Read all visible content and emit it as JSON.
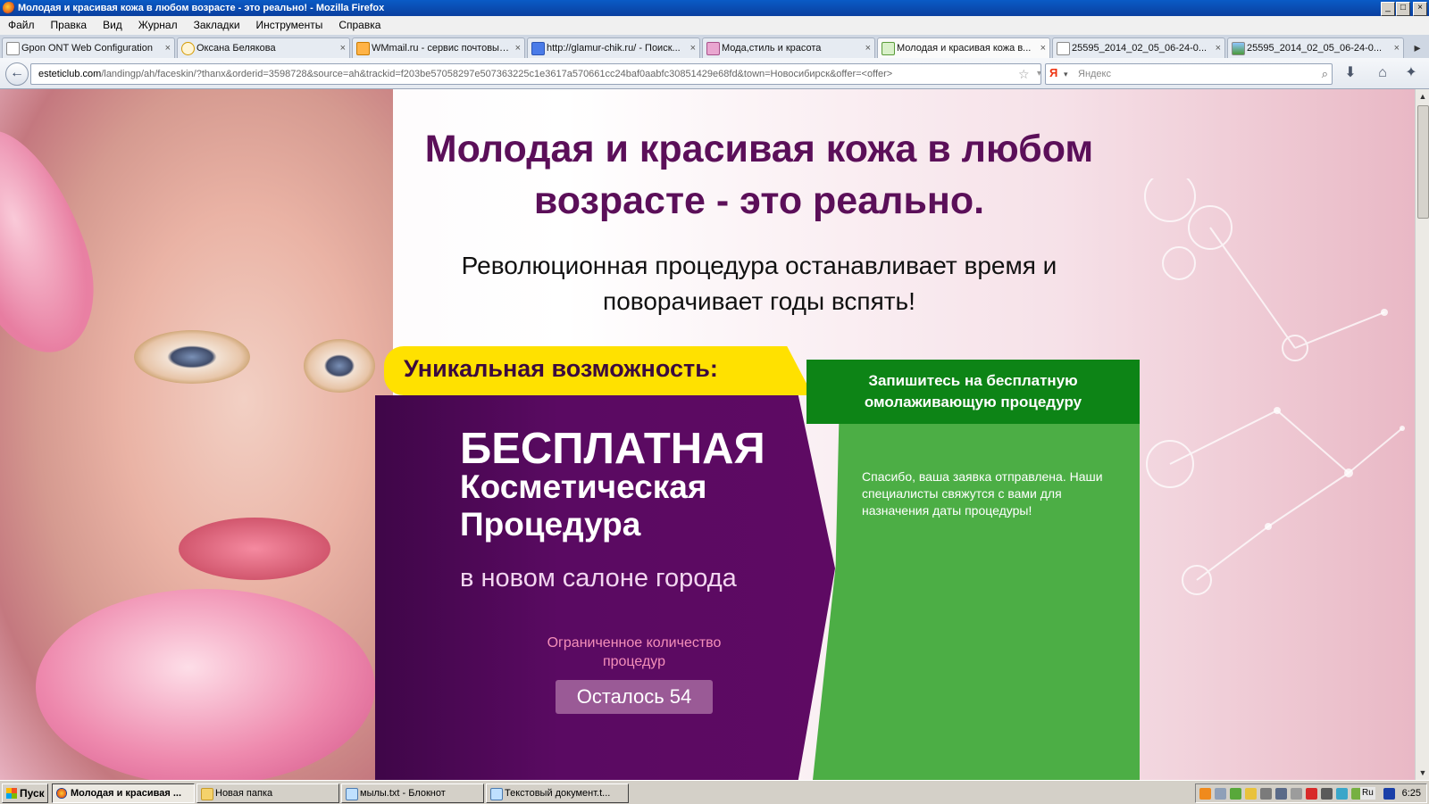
{
  "window": {
    "title": "Молодая и красивая кожа в любом возрасте - это реально! - Mozilla Firefox",
    "controls": [
      "_",
      "□",
      "×"
    ]
  },
  "menu": [
    "Файл",
    "Правка",
    "Вид",
    "Журнал",
    "Закладки",
    "Инструменты",
    "Справка"
  ],
  "tabs": [
    {
      "label": "Gpon ONT Web Configuration",
      "icon": "page-icon"
    },
    {
      "label": "Оксана Белякова",
      "icon": "mail-icon"
    },
    {
      "label": "WMmail.ru - сервис почтовых...",
      "icon": "wmmail-icon"
    },
    {
      "label": "http://glamur-chik.ru/ - Поиск...",
      "icon": "google-icon"
    },
    {
      "label": "Мода,стиль и красота",
      "icon": "fashion-icon"
    },
    {
      "label": "Молодая и красивая кожа в...",
      "icon": "leaf-icon",
      "active": true
    },
    {
      "label": "25595_2014_02_05_06-24-0...",
      "icon": "page-icon"
    },
    {
      "label": "25595_2014_02_05_06-24-0...",
      "icon": "image-icon"
    }
  ],
  "tab_close": "×",
  "tab_scroll": "▸",
  "nav": {
    "back": "←",
    "url_domain": "esteticlub.com",
    "url_path": "/landingp/ah/faceskin/?thanx&orderid=3598728&source=ah&trackid=f203be57058297e507363225c1e3617a570661cc24baf0aabfc30851429e68fd&town=Новосибирск&offer=<offer>",
    "star": "☆",
    "dropdown": "▾",
    "reload": "↻",
    "search_engine": "Я",
    "search_dropdown": "▾",
    "search_placeholder": "Яндекс",
    "search_go": "⌕",
    "download": "⬇",
    "home": "⌂",
    "addons": "✦"
  },
  "page": {
    "headline": "Молодая и красивая кожа в любом возрасте - это реально.",
    "subhead": "Революционная процедура останавливает время и поворачивает годы вспять!",
    "banner": "Уникальная возможность:",
    "free": "БЕСПЛАТНАЯ",
    "free_line2": "Косметическая",
    "free_line3": "Процедура",
    "new_salon": "в новом салоне города",
    "limited": "Ограниченное количество процедур",
    "remaining": "Осталось 54",
    "form_title": "Запишитесь на бесплатную омолаживающую процедуру",
    "thanks": "Спасибо, ваша заявка отправлена. Наши специалисты свяжутся с вами для назначения даты процедуры!"
  },
  "colors": {
    "headline": "#5b0f59",
    "purple": "#5a0a62",
    "yellow": "#ffe100",
    "green_dark": "#0d8416",
    "green": "#4cae45"
  },
  "taskbar": {
    "start": "Пуск",
    "tasks": [
      {
        "label": "Молодая и красивая ...",
        "icon": "firefox-icon",
        "active": true
      },
      {
        "label": "Новая папка",
        "icon": "folder-icon"
      },
      {
        "label": "мылы.txt - Блокнот",
        "icon": "notepad-icon"
      },
      {
        "label": "Текстовый документ.t...",
        "icon": "notepad-icon"
      }
    ],
    "lang": "Ru",
    "clock": "6:25"
  }
}
